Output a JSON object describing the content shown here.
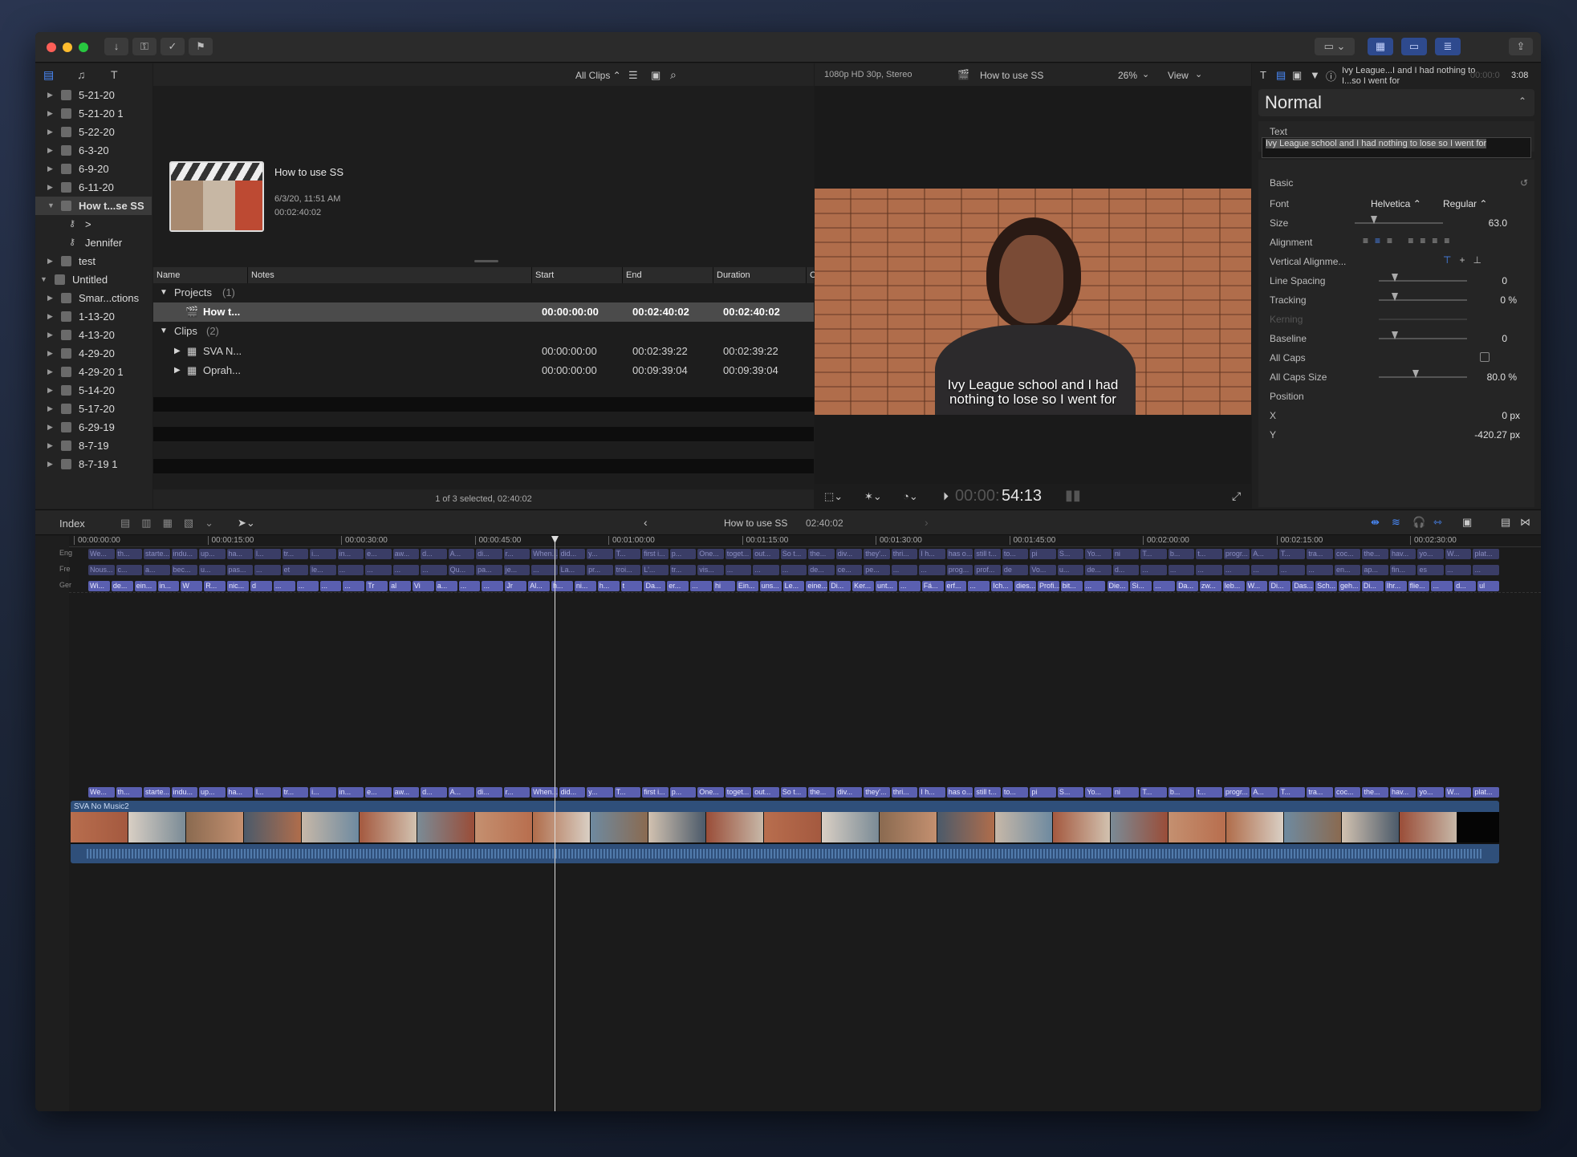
{
  "toolbar": {
    "icons": [
      "import-icon",
      "keyword-icon",
      "check-icon",
      "flag-icon"
    ]
  },
  "browser": {
    "filter_label": "All Clips ⌃",
    "event_title": "How to use SS",
    "event_date": "6/3/20, 11:51 AM",
    "event_duration": "00:02:40:02",
    "columns": [
      "Name",
      "Notes",
      "Start",
      "End",
      "Duration",
      "C"
    ],
    "projects_group": "Projects",
    "projects_count": "(1)",
    "clips_group": "Clips",
    "clips_count": "(2)",
    "rows": [
      {
        "name": "How t...",
        "start": "00:00:00:00",
        "end": "00:02:40:02",
        "duration": "00:02:40:02"
      },
      {
        "name": "SVA N...",
        "start": "00:00:00:00",
        "end": "00:02:39:22",
        "duration": "00:02:39:22"
      },
      {
        "name": "Oprah...",
        "start": "00:00:00:00",
        "end": "00:09:39:04",
        "duration": "00:09:39:04"
      }
    ],
    "status": "1 of 3 selected, 02:40:02"
  },
  "library": {
    "items": [
      {
        "label": "5-21-20"
      },
      {
        "label": "5-21-20 1"
      },
      {
        "label": "5-22-20"
      },
      {
        "label": "6-3-20"
      },
      {
        "label": "6-9-20"
      },
      {
        "label": "6-11-20"
      },
      {
        "label": "How t...se SS"
      },
      {
        "label": ">"
      },
      {
        "label": "Jennifer"
      },
      {
        "label": "test"
      },
      {
        "label": "Untitled"
      },
      {
        "label": "Smar...ctions"
      },
      {
        "label": "1-13-20"
      },
      {
        "label": "4-13-20"
      },
      {
        "label": "4-29-20"
      },
      {
        "label": "4-29-20 1"
      },
      {
        "label": "5-14-20"
      },
      {
        "label": "5-17-20"
      },
      {
        "label": "6-29-19"
      },
      {
        "label": "8-7-19"
      },
      {
        "label": "8-7-19 1"
      }
    ]
  },
  "viewer": {
    "format": "1080p HD 30p, Stereo",
    "title": "How to use SS",
    "zoom": "26%",
    "view_label": "View",
    "caption_line1": "Ivy League school and I had",
    "caption_line2": "nothing to lose so I went for",
    "timecode_dim": "00:00:",
    "timecode": "54:13"
  },
  "inspector": {
    "header_text": "Ivy League...I and I had nothing to I...so I went for",
    "header_time_dim": "00:00:0",
    "header_time": "3:08",
    "preset": "Normal",
    "text_label": "Text",
    "text_value": "Ivy League school and I had nothing to lose so I went for",
    "basic_label": "Basic",
    "font_label": "Font",
    "font_value": "Helvetica ⌃",
    "font_style": "Regular ⌃",
    "size_label": "Size",
    "size_value": "63.0",
    "alignment_label": "Alignment",
    "valign_label": "Vertical Alignme...",
    "line_spacing_label": "Line Spacing",
    "line_spacing_value": "0",
    "tracking_label": "Tracking",
    "tracking_value": "0 %",
    "kerning_label": "Kerning",
    "baseline_label": "Baseline",
    "baseline_value": "0",
    "allcaps_label": "All Caps",
    "allcaps_size_label": "All Caps Size",
    "allcaps_size_value": "80.0 %",
    "position_label": "Position",
    "x_label": "X",
    "x_value": "0 px",
    "y_label": "Y",
    "y_value": "-420.27 px"
  },
  "timeline": {
    "index_label": "Index",
    "project_title": "How to use SS",
    "project_duration": "02:40:02",
    "ruler": [
      "00:00:00:00",
      "00:00:15:00",
      "00:00:30:00",
      "00:00:45:00",
      "00:01:00:00",
      "00:01:15:00",
      "00:01:30:00",
      "00:01:45:00",
      "00:02:00:00",
      "00:02:15:00",
      "00:02:30:00"
    ],
    "lane_labels": [
      "Eng",
      "Fre",
      "Ger"
    ],
    "clip_name": "SVA No Music2",
    "lane_eng": [
      "We...",
      "th...",
      "starte...",
      "indu...",
      "up...",
      "ha...",
      "l...",
      "tr...",
      "i...",
      "in...",
      "e...",
      "aw...",
      "d...",
      "A...",
      "di...",
      "r...",
      "When...",
      "did...",
      "y...",
      "T...",
      "first i...",
      "p...",
      "One...",
      "toget...",
      "out...",
      "So t...",
      "the...",
      "div...",
      "they'...",
      "thri...",
      "I h...",
      "has o...",
      "still t...",
      "to...",
      "pi",
      "S...",
      "Yo...",
      "ni",
      "T...",
      "b...",
      "t...",
      "progr...",
      "A...",
      "T...",
      "tra...",
      "coc...",
      "the...",
      "hav...",
      "yo...",
      "W...",
      "plat..."
    ],
    "lane_fre": [
      "Nous...",
      "c...",
      "a...",
      "bec...",
      "u...",
      "pas...",
      "...",
      "et",
      "le...",
      "...",
      "...",
      "...",
      "...",
      "Qu...",
      "pa...",
      "je...",
      "...",
      "La...",
      "pr...",
      "troi...",
      "L'...",
      "tr...",
      "vis...",
      "...",
      "...",
      "...",
      "de...",
      "ce...",
      "pe...",
      "...",
      "...",
      "prog...",
      "prof...",
      "de",
      "Vo...",
      "u...",
      "de...",
      "d...",
      "...",
      "...",
      "...",
      "...",
      "...",
      "...",
      "...",
      "en...",
      "ap...",
      "fin...",
      "es",
      "...",
      "..."
    ],
    "lane_ger": [
      "Wi...",
      "de...",
      "ein...",
      "in...",
      "W",
      "R...",
      "nic...",
      "d",
      "...",
      "...",
      "...",
      "...",
      "Tr",
      "al",
      "Vi",
      "a...",
      "...",
      "...",
      "Jr",
      "Al...",
      "h...",
      "ni...",
      "h...",
      "t",
      "Da...",
      "er...",
      "...",
      "hi",
      "Ein...",
      "uns...",
      "Le...",
      "eine...",
      "Di...",
      "Ker...",
      "unt...",
      "...",
      "Fä...",
      "erf...",
      "...",
      "Ich...",
      "dies...",
      "Profi...",
      "bit...",
      "...",
      "Die...",
      "Si...",
      "...",
      "Da...",
      "zw...",
      "leb...",
      "W...",
      "Di...",
      "Das...",
      "Sch...",
      "geh...",
      "Di...",
      "Ihr...",
      "flie...",
      "...",
      "d...",
      "ul"
    ],
    "connected": [
      "We...",
      "th...",
      "starte...",
      "indu...",
      "up...",
      "ha...",
      "l...",
      "tr...",
      "i...",
      "in...",
      "e...",
      "aw...",
      "d...",
      "A...",
      "di...",
      "r...",
      "When...",
      "did...",
      "y...",
      "T...",
      "first i...",
      "p...",
      "One...",
      "toget...",
      "out...",
      "So t...",
      "the...",
      "div...",
      "they'...",
      "thri...",
      "I h...",
      "has o...",
      "still t...",
      "to...",
      "pi",
      "S...",
      "Yo...",
      "ni",
      "T...",
      "b...",
      "t...",
      "progr...",
      "A...",
      "T...",
      "tra...",
      "coc...",
      "the...",
      "hav...",
      "yo...",
      "W...",
      "plat..."
    ]
  }
}
